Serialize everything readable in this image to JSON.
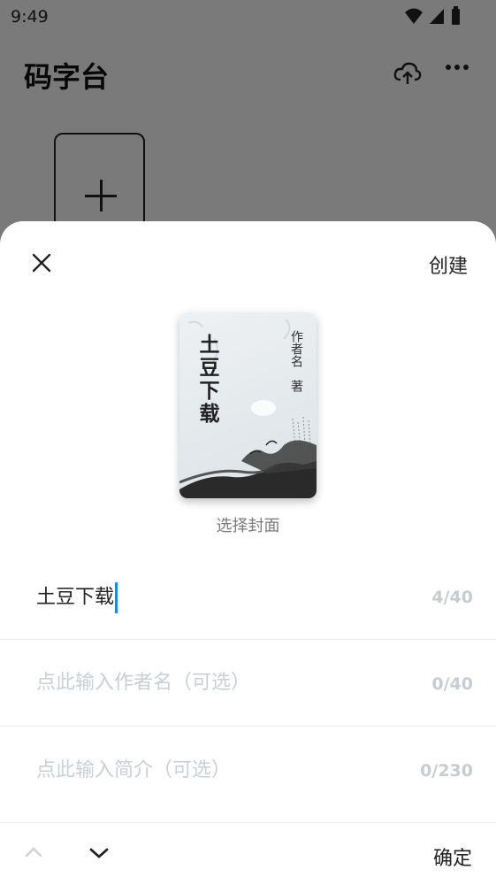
{
  "status": {
    "time": "9:49"
  },
  "background": {
    "title": "码字台"
  },
  "sheet": {
    "create_label": "创建",
    "cover": {
      "title": "土豆下载",
      "author_placeholder": "作者名",
      "suffix": "著",
      "caption": "选择封面"
    },
    "fields": {
      "title": {
        "value": "土豆下载",
        "count": "4/40"
      },
      "author": {
        "placeholder": "点此输入作者名（可选）",
        "count": "0/40"
      },
      "intro": {
        "placeholder": "点此输入简介（可选）",
        "count": "0/230"
      }
    }
  },
  "keyboard_bar": {
    "confirm_label": "确定"
  },
  "icons": {
    "close": "close-icon",
    "cloud": "cloud-upload-icon",
    "more": "more-icon",
    "plus": "plus-icon",
    "up": "chevron-up-icon",
    "down": "chevron-down-icon",
    "wifi": "wifi-icon",
    "signal": "signal-icon",
    "battery": "battery-icon"
  },
  "colors": {
    "caret": "#1e88e5",
    "placeholder": "#c9cfd6"
  }
}
